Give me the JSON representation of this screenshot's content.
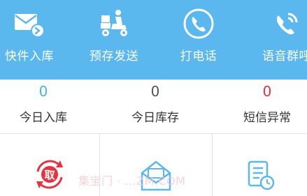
{
  "topbar": {
    "background": "#5bb8ef",
    "items": [
      {
        "label": "快件入库",
        "icon": "mail-arrow-icon"
      },
      {
        "label": "预存发送",
        "icon": "delivery-scooter-icon"
      },
      {
        "label": "打电话",
        "icon": "phone-icon"
      },
      {
        "label": "语音群呼",
        "icon": "voice-call-icon"
      }
    ]
  },
  "stats": [
    {
      "value": "0",
      "caption": "今日入库",
      "color": "#45b4ec"
    },
    {
      "value": "0",
      "caption": "今日库存",
      "color": "#555555"
    },
    {
      "value": "0",
      "caption": "短信异常",
      "color": "#e8323f"
    }
  ],
  "grid": [
    {
      "icon": "pickup-qu-icon"
    },
    {
      "icon": "open-envelope-icon"
    },
    {
      "icon": "document-clock-icon"
    }
  ],
  "watermark": "集宝门 · ...ZM.COM"
}
